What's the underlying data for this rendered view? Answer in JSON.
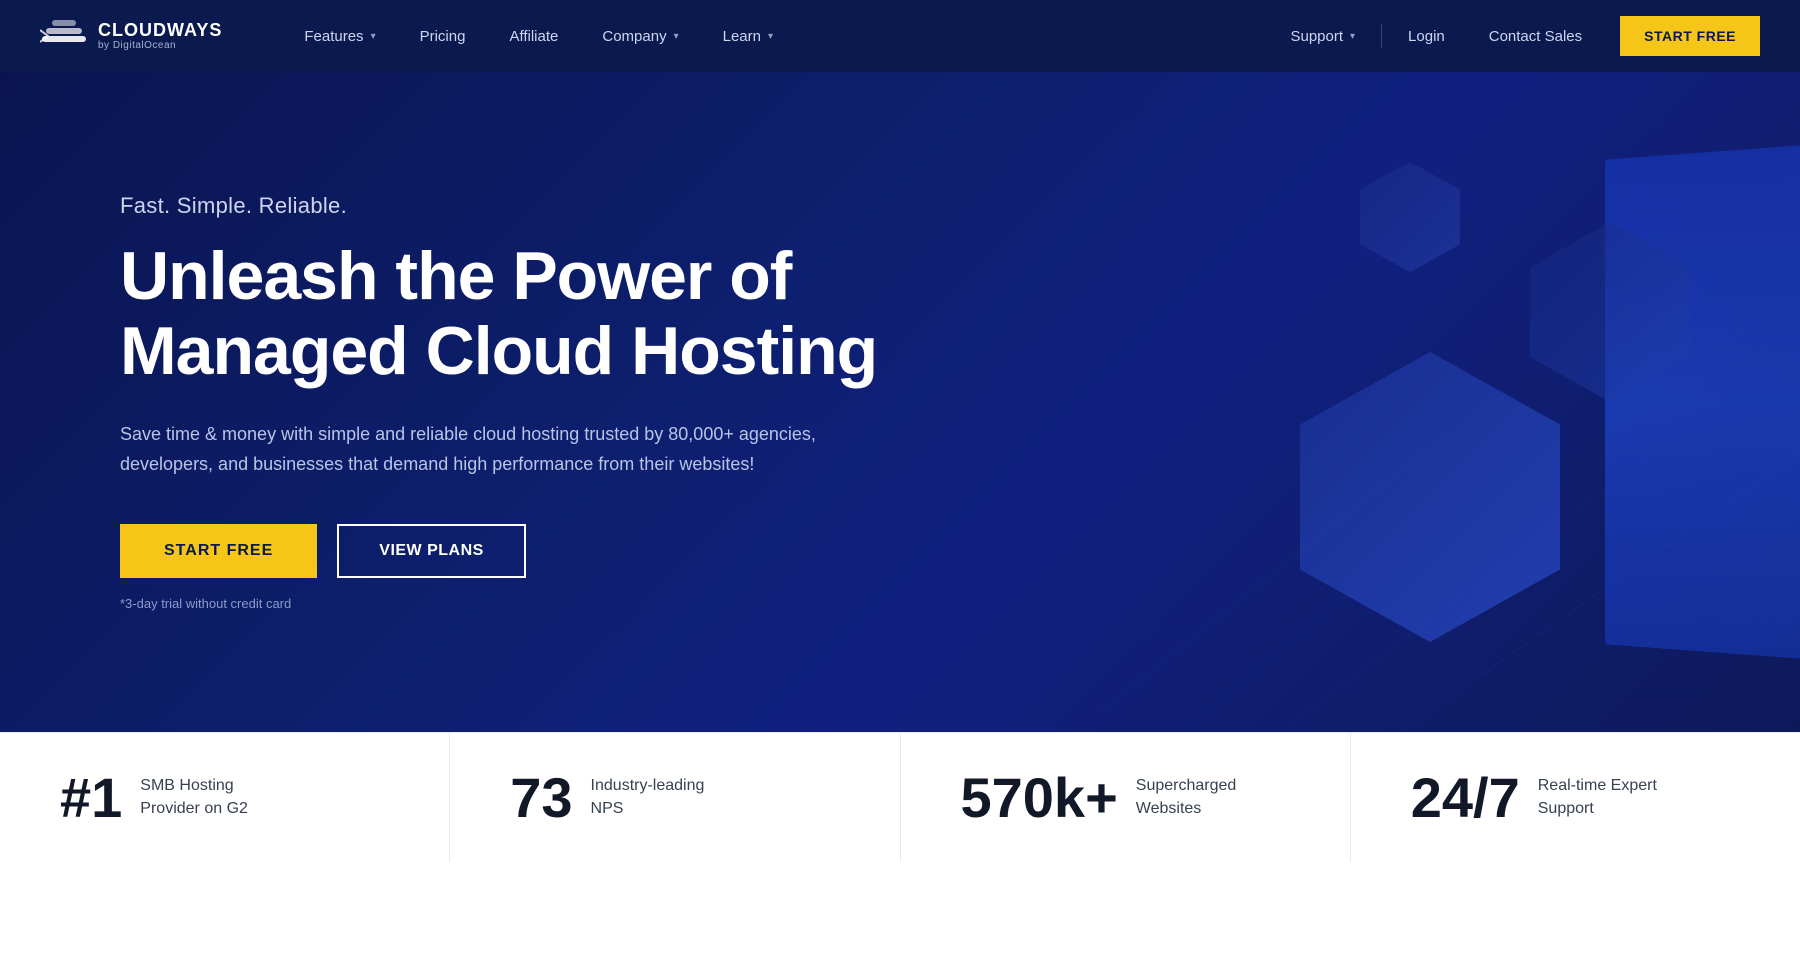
{
  "brand": {
    "name": "CLOUDWAYS",
    "subtitle": "by DigitalOcean"
  },
  "nav": {
    "links": [
      {
        "label": "Features",
        "hasDropdown": true
      },
      {
        "label": "Pricing",
        "hasDropdown": false
      },
      {
        "label": "Affiliate",
        "hasDropdown": false
      },
      {
        "label": "Company",
        "hasDropdown": true
      },
      {
        "label": "Learn",
        "hasDropdown": true
      }
    ],
    "right": [
      {
        "label": "Support",
        "hasDropdown": true
      },
      {
        "label": "Login",
        "hasDropdown": false
      },
      {
        "label": "Contact Sales",
        "hasDropdown": false
      }
    ],
    "cta": "START FREE"
  },
  "hero": {
    "tagline": "Fast. Simple. Reliable.",
    "title": "Unleash the Power of Managed Cloud Hosting",
    "description": "Save time & money with simple and reliable cloud hosting trusted by 80,000+ agencies, developers, and businesses that demand high performance from their websites!",
    "btn_primary": "START FREE",
    "btn_secondary": "VIEW PLANS",
    "trial_note": "*3-day trial without credit card"
  },
  "stats": [
    {
      "number": "#1",
      "label": "SMB Hosting Provider on G2"
    },
    {
      "number": "73",
      "label": "Industry-leading NPS"
    },
    {
      "number": "570k+",
      "label": "Supercharged Websites"
    },
    {
      "number": "24/7",
      "label": "Real-time Expert Support"
    }
  ],
  "colors": {
    "bg_dark": "#0a1550",
    "accent_yellow": "#f5c518",
    "text_white": "#ffffff"
  }
}
